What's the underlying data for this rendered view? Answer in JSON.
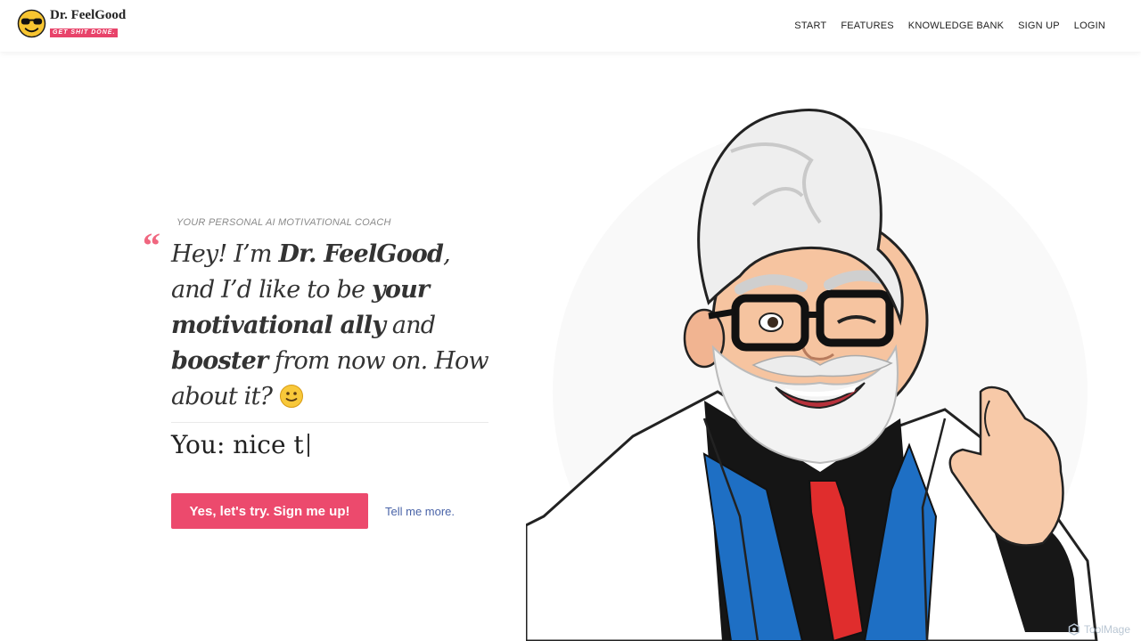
{
  "brand": {
    "name": "Dr. FeelGood",
    "tagline": "GET SHIT DONE.",
    "icon": "sunglasses-emoji-icon",
    "accent": "#e8436a"
  },
  "nav": {
    "items": [
      "START",
      "FEATURES",
      "KNOWLEDGE BANK",
      "SIGN UP",
      "LOGIN"
    ]
  },
  "hero": {
    "subtitle": "YOUR PERSONAL AI MOTIVATIONAL COACH",
    "quote_mark": "“",
    "message": {
      "p1": "Hey! I’m ",
      "name": "Dr. FeelGood",
      "p2": ", and I’d like to be ",
      "ally": "your motivational ally",
      "p3": " and ",
      "booster": "booster",
      "p4": " from now on. How about it?"
    },
    "reply": "You: nice t",
    "cta_label": "Yes, let's try. Sign me up!",
    "more_label": "Tell me more."
  },
  "illustration": {
    "subject": "cartoon-doctor-illustration"
  },
  "watermark": "ToolMage",
  "colors": {
    "cta": "#ec4a6d",
    "link": "#4a64a8",
    "coat_vest": "#1e6fc4",
    "tie": "#e02d2d"
  }
}
